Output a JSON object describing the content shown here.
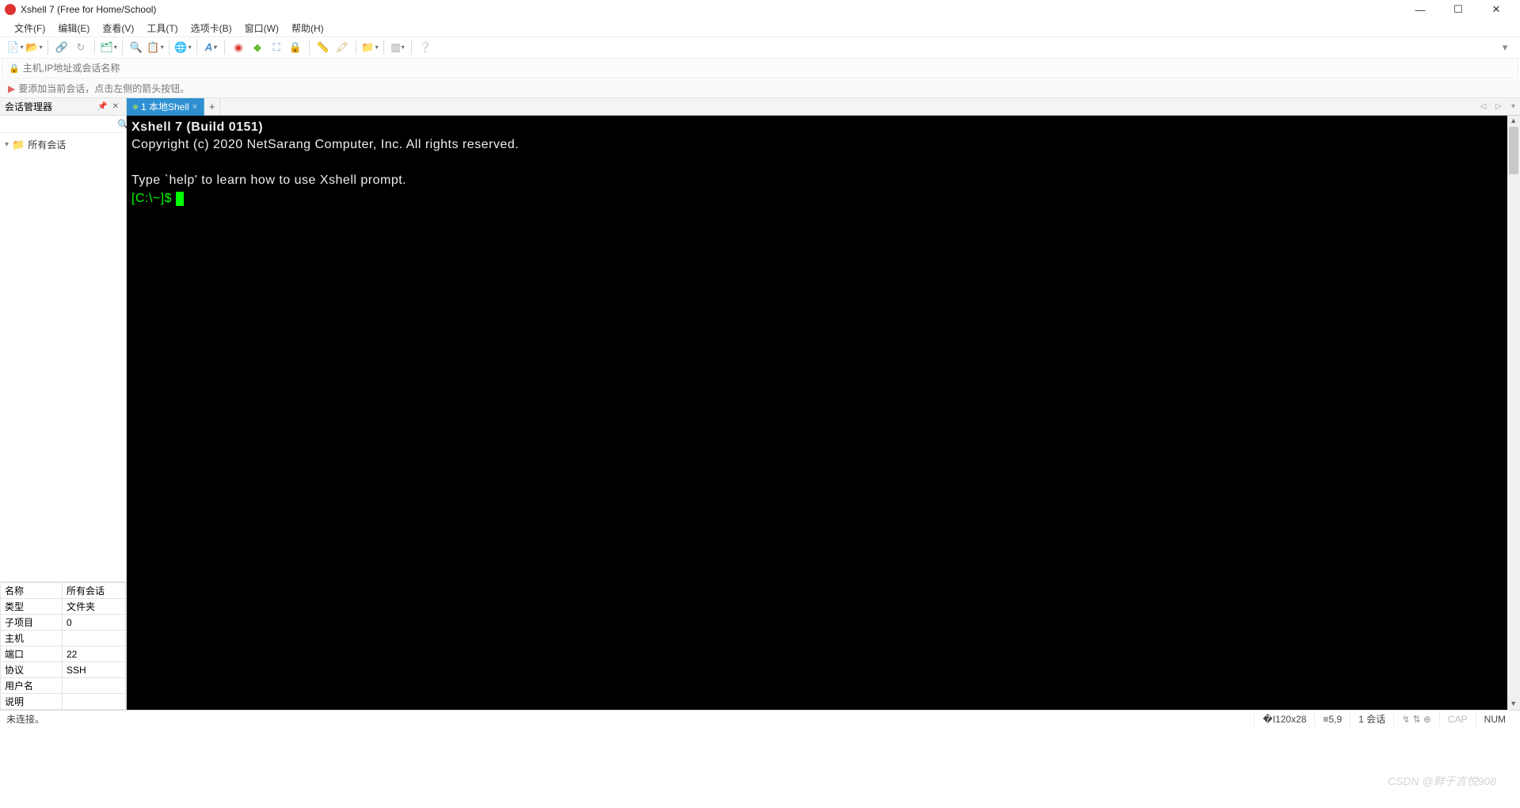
{
  "title": "Xshell 7 (Free for Home/School)",
  "menu": [
    "文件(F)",
    "编辑(E)",
    "查看(V)",
    "工具(T)",
    "选项卡(B)",
    "窗口(W)",
    "帮助(H)"
  ],
  "address_placeholder": "主机,IP地址或会话名称",
  "hint": "要添加当前会话，点击左侧的箭头按钮。",
  "sidebar": {
    "title": "会话管理器",
    "tree_root": "所有会话"
  },
  "props": [
    {
      "k": "名称",
      "v": "所有会话"
    },
    {
      "k": "类型",
      "v": "文件夹"
    },
    {
      "k": "子项目",
      "v": "0"
    },
    {
      "k": "主机",
      "v": ""
    },
    {
      "k": "端口",
      "v": "22"
    },
    {
      "k": "协议",
      "v": "SSH"
    },
    {
      "k": "用户名",
      "v": ""
    },
    {
      "k": "说明",
      "v": ""
    }
  ],
  "tab_label": "1 本地Shell",
  "terminal": {
    "line1": "Xshell 7 (Build 0151)",
    "line2": "Copyright (c) 2020 NetSarang Computer, Inc. All rights reserved.",
    "line3": "Type `help' to learn how to use Xshell prompt.",
    "prompt": "[C:\\~]$ "
  },
  "status": {
    "left": "未连接。",
    "size": "120x28",
    "pos": "5,9",
    "sess": "1 会话",
    "caps": "CAP",
    "num": "NUM"
  },
  "watermark": "CSDN @鲜于言悦908"
}
